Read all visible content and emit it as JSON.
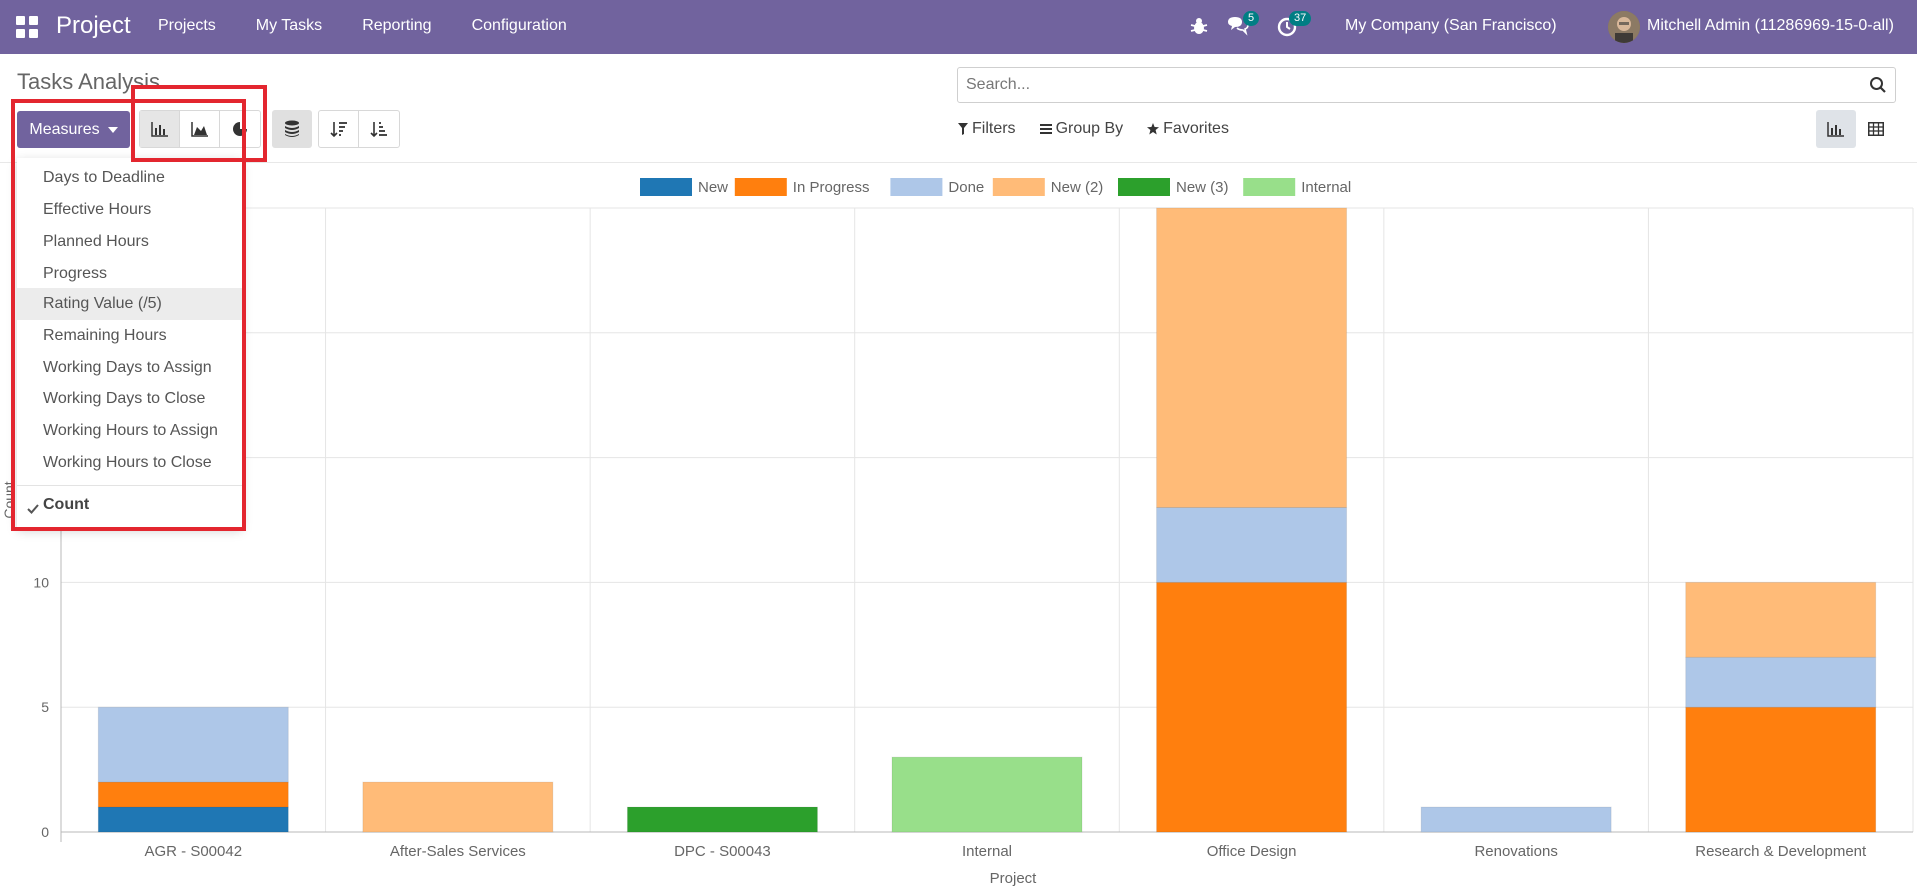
{
  "navbar": {
    "brand": "Project",
    "menu": [
      "Projects",
      "My Tasks",
      "Reporting",
      "Configuration"
    ],
    "messages_count": "5",
    "activities_count": "37",
    "company": "My Company (San Francisco)",
    "user": "Mitchell Admin (11286969-15-0-all)"
  },
  "control_panel": {
    "title": "Tasks Analysis",
    "measures_label": "Measures",
    "search_placeholder": "Search...",
    "filters_label": "Filters",
    "group_by_label": "Group By",
    "favorites_label": "Favorites"
  },
  "measures_dropdown": {
    "items": [
      "Days to Deadline",
      "Effective Hours",
      "Planned Hours",
      "Progress",
      "Rating Value (/5)",
      "Remaining Hours",
      "Working Days to Assign",
      "Working Days to Close",
      "Working Hours to Assign",
      "Working Hours to Close"
    ],
    "hovered": "Rating Value (/5)",
    "selected": "Count"
  },
  "chart_data": {
    "type": "bar",
    "stacked": true,
    "categories": [
      "AGR - S00042",
      "After-Sales Services",
      "DPC - S00043",
      "Internal",
      "Office Design",
      "Renovations",
      "Research & Development"
    ],
    "series": [
      {
        "name": "New",
        "color": "#1f77b4",
        "values": [
          1,
          0,
          0,
          0,
          0,
          0,
          0
        ]
      },
      {
        "name": "In Progress",
        "color": "#ff7f0e",
        "values": [
          1,
          0,
          0,
          0,
          10,
          0,
          5
        ]
      },
      {
        "name": "Done",
        "color": "#aec7e8",
        "values": [
          3,
          0,
          0,
          0,
          3,
          1,
          2
        ]
      },
      {
        "name": "New (2)",
        "color": "#ffbb78",
        "values": [
          0,
          2,
          0,
          0,
          12,
          0,
          3
        ]
      },
      {
        "name": "New (3)",
        "color": "#2ca02c",
        "values": [
          0,
          0,
          1,
          0,
          0,
          0,
          0
        ]
      },
      {
        "name": "Internal",
        "color": "#98df8a",
        "values": [
          0,
          0,
          0,
          3,
          0,
          0,
          0
        ]
      }
    ],
    "xlabel": "Project",
    "ylabel": "Count",
    "yticks": [
      0,
      5,
      10
    ],
    "ylim": [
      0,
      25
    ],
    "grid": true,
    "legend": "top-center"
  }
}
